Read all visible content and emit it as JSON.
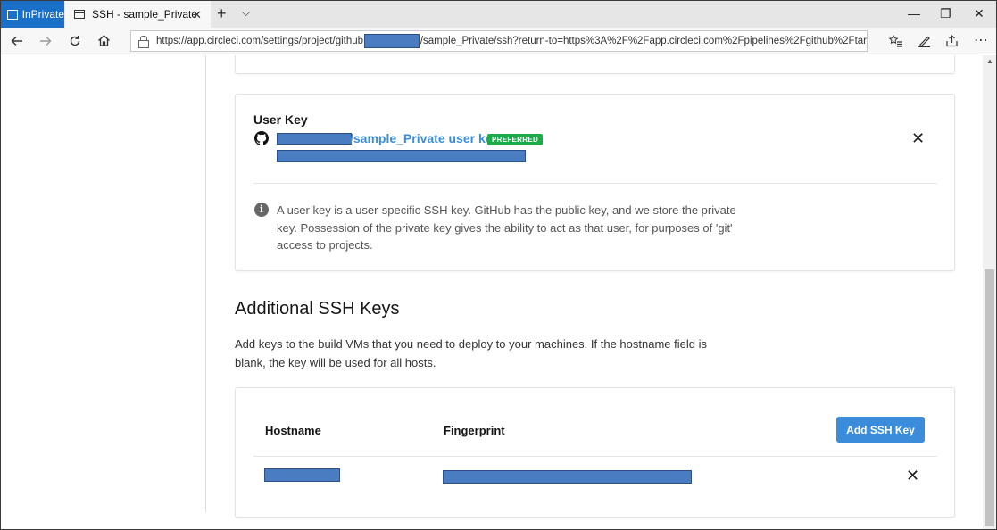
{
  "browser": {
    "inprivate_label": "InPrivate",
    "tab_title": "SSH - sample_Private",
    "tab_close": "✕",
    "new_tab": "+",
    "tab_menu": "⌵",
    "window_controls": {
      "minimize": "—",
      "restore": "❐",
      "close": "✕"
    },
    "url_before_redaction": "https://app.circleci.com/settings/project/github",
    "url_after_redaction": "/sample_Private/ssh?return-to=https%3A%2F%2Fapp.circleci.com%2Fpipelines%2Fgithub%2Ftar",
    "nav_icons": [
      "back-arrow-icon",
      "forward-arrow-icon",
      "refresh-icon",
      "home-icon",
      "lock-icon",
      "reading-view-icon",
      "star-icon",
      "favorites-icon",
      "pen-icon",
      "share-icon",
      "more-icon"
    ]
  },
  "user_key": {
    "title": "User Key",
    "link_text": "/sample_Private user key",
    "badge": "PREFERRED",
    "remove": "✕",
    "info_text": "A user key is a user-specific SSH key. GitHub has the public key, and we store the private key. Possession of the private key gives the ability to act as that user, for purposes of 'git' access to projects."
  },
  "additional_keys": {
    "title": "Additional SSH Keys",
    "description": "Add keys to the build VMs that you need to deploy to your machines. If the hostname field is blank, the key will be used for all hosts.",
    "columns": {
      "hostname": "Hostname",
      "fingerprint": "Fingerprint"
    },
    "add_button": "Add SSH Key",
    "row_remove": "✕"
  },
  "colors": {
    "accent": "#3b8ddb",
    "badge_green": "#1dab4a",
    "inprivate_blue": "#1a6fc9",
    "redaction": "#4a7cc2"
  }
}
